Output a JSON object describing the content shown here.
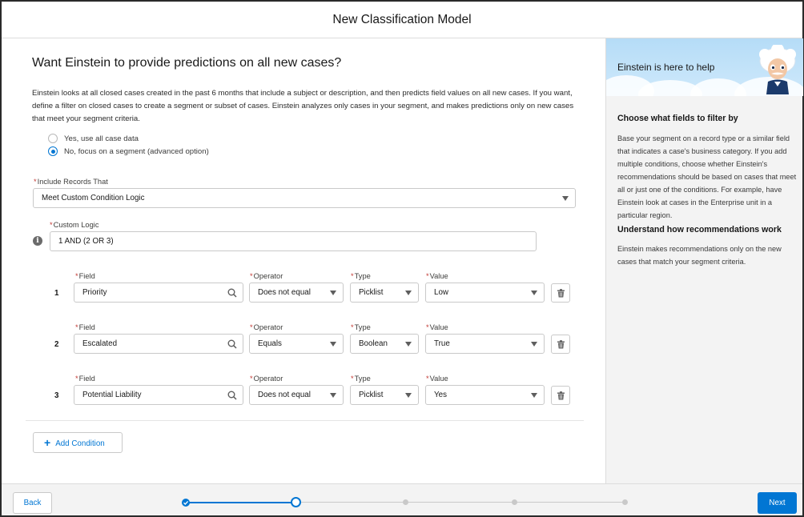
{
  "modal": {
    "title": "New Classification Model"
  },
  "main": {
    "heading": "Want Einstein to provide predictions on all new cases?",
    "intro": "Einstein looks at all closed cases created in the past 6 months that include a subject or description, and then predicts field values on all new cases. If you want, define a filter on closed cases to create a segment or subset of cases. Einstein analyzes only cases in your segment, and makes predictions only on new cases that meet your segment criteria.",
    "radio_options": [
      {
        "label": "Yes, use all case data",
        "selected": false
      },
      {
        "label": "No, focus on a segment (advanced option)",
        "selected": true
      }
    ],
    "include_records": {
      "label": "Include Records That",
      "required_mark": "*",
      "value": "Meet Custom Condition Logic"
    },
    "custom_logic": {
      "label": "Custom Logic",
      "required_mark": "*",
      "value": "1 AND (2 OR 3)",
      "info_icon": "info-icon"
    },
    "condition_headers": {
      "field": "Field",
      "operator": "Operator",
      "type": "Type",
      "value": "Value",
      "required_mark": "*"
    },
    "conditions": [
      {
        "num": "1",
        "field": "Priority",
        "operator": "Does not equal",
        "type": "Picklist",
        "value": "Low"
      },
      {
        "num": "2",
        "field": "Escalated",
        "operator": "Equals",
        "type": "Boolean",
        "value": "True"
      },
      {
        "num": "3",
        "field": "Potential Liability",
        "operator": "Does not equal",
        "type": "Picklist",
        "value": "Yes"
      }
    ],
    "add_condition_label": "Add Condition"
  },
  "sidebar": {
    "banner_title": "Einstein is here to help",
    "section1_title": "Choose what fields to filter by",
    "section1_text": "Base your segment on a record type or a similar field that indicates a case's business category. If you add multiple conditions, choose whether Einstein's recommendations should be based on cases that meet all or just one of the conditions. For example, have Einstein look at cases in the Enterprise unit in a particular region.",
    "section2_title": "Understand how recommendations work",
    "section2_text": "Einstein makes recommendations only on the new cases that match your segment criteria."
  },
  "footer": {
    "back_label": "Back",
    "next_label": "Next",
    "progress": {
      "total_steps": 5,
      "current_step": 2,
      "completed_steps": 1
    }
  },
  "colors": {
    "brand": "#0176d3",
    "required": "#c23934",
    "panel": "#f3f3f3"
  }
}
